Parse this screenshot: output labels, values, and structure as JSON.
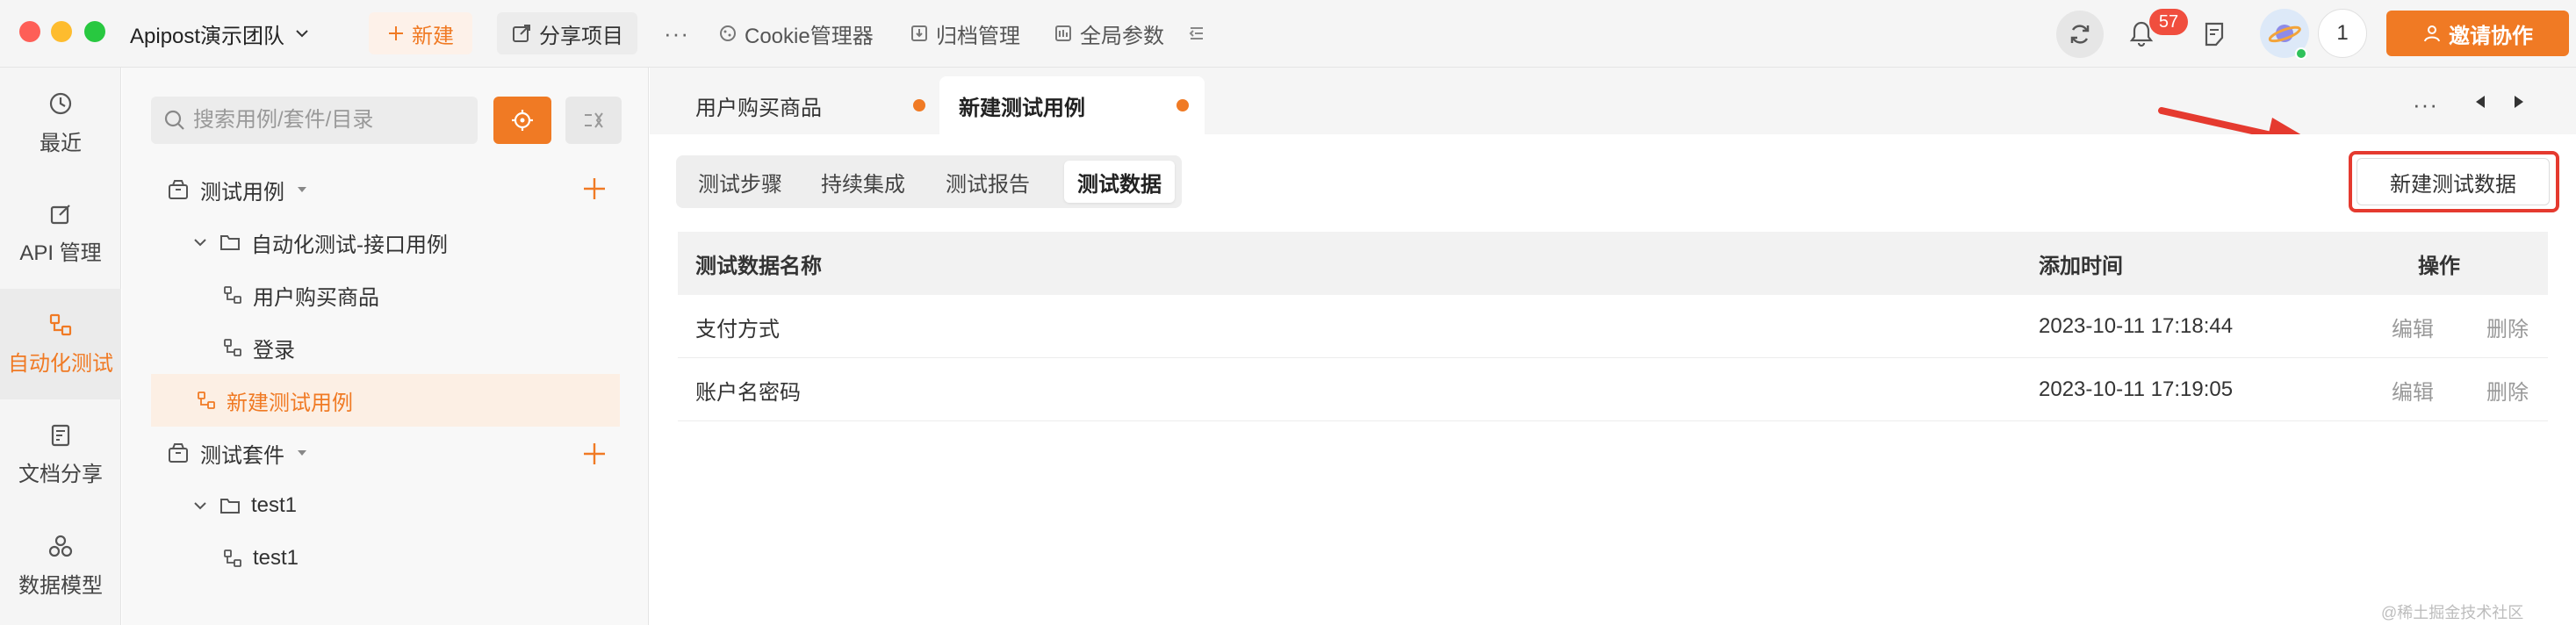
{
  "app": {
    "team_name": "Apipost演示团队",
    "new_label": "新建",
    "share_label": "分享项目",
    "more_label": "···",
    "cookie_label": "Cookie管理器",
    "archive_label": "归档管理",
    "global_params_label": "全局参数",
    "notification_count": "57",
    "online_count": "1",
    "invite_label": "邀请协作"
  },
  "nav": {
    "items": [
      {
        "label": "最近",
        "icon": "clock-icon"
      },
      {
        "label": "API 管理",
        "icon": "edit-icon"
      },
      {
        "label": "自动化测试",
        "icon": "flow-icon",
        "active": true
      },
      {
        "label": "文档分享",
        "icon": "doc-share-icon"
      },
      {
        "label": "数据模型",
        "icon": "model-icon"
      }
    ]
  },
  "tree": {
    "search_placeholder": "搜索用例/套件/目录",
    "rows": [
      {
        "label": "测试用例",
        "type": "group"
      },
      {
        "label": "自动化测试-接口用例",
        "type": "folder"
      },
      {
        "label": "用户购买商品",
        "type": "case"
      },
      {
        "label": "登录",
        "type": "case"
      },
      {
        "label": "新建测试用例",
        "type": "case",
        "selected": true
      },
      {
        "label": "测试套件",
        "type": "group"
      },
      {
        "label": "test1",
        "type": "folder"
      },
      {
        "label": "test1",
        "type": "case"
      }
    ]
  },
  "tabs": [
    {
      "label": "用户购买商品",
      "unsaved": true
    },
    {
      "label": "新建测试用例",
      "unsaved": true,
      "active": true
    }
  ],
  "tab_controls": {
    "more_label": "···"
  },
  "subtabs": [
    {
      "label": "测试步骤"
    },
    {
      "label": "持续集成"
    },
    {
      "label": "测试报告"
    },
    {
      "label": "测试数据",
      "active": true
    }
  ],
  "new_data_button": "新建测试数据",
  "table": {
    "headers": {
      "name": "测试数据名称",
      "time": "添加时间",
      "ops": "操作"
    },
    "rows": [
      {
        "name": "支付方式",
        "time": "2023-10-11 17:18:44",
        "edit": "编辑",
        "delete": "删除"
      },
      {
        "name": "账户名密码",
        "time": "2023-10-11 17:19:05",
        "edit": "编辑",
        "delete": "删除"
      }
    ]
  },
  "watermark": "@稀土掘金技术社区",
  "colors": {
    "accent": "#f07a24",
    "annotation_red": "#e53a2f",
    "badge_red": "#f04e3e"
  }
}
